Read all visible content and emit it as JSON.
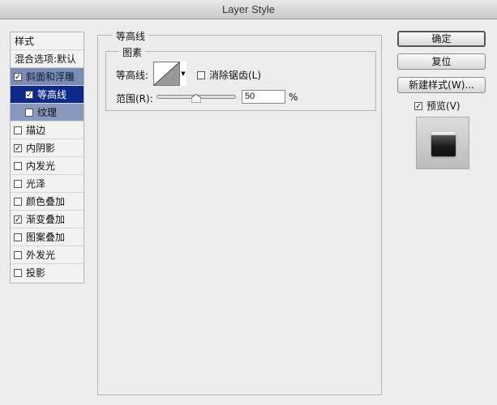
{
  "window": {
    "title": "Layer Style"
  },
  "style_list": {
    "header": "样式",
    "items": [
      {
        "label": "混合选项:默认",
        "checkbox": false
      },
      {
        "label": "斜面和浮雕",
        "checked": true
      },
      {
        "label": "等高线",
        "checked": true
      },
      {
        "label": "纹理",
        "checked": false
      },
      {
        "label": "描边",
        "checked": false
      },
      {
        "label": "内阴影",
        "checked": true
      },
      {
        "label": "内发光",
        "checked": false
      },
      {
        "label": "光泽",
        "checked": false
      },
      {
        "label": "颜色叠加",
        "checked": false
      },
      {
        "label": "渐变叠加",
        "checked": true
      },
      {
        "label": "图案叠加",
        "checked": false
      },
      {
        "label": "外发光",
        "checked": false
      },
      {
        "label": "投影",
        "checked": false
      }
    ]
  },
  "panel": {
    "title": "等高线",
    "group_title": "图素",
    "contour_label": "等高线:",
    "antialias_label": "消除锯齿(L)",
    "antialias_checked": false,
    "range_label": "范围(R):",
    "range_value": "50",
    "range_unit": "%",
    "range_level_percent": 50
  },
  "buttons": {
    "ok": "确定",
    "reset": "复位",
    "new_style": "新建样式(W)..."
  },
  "preview": {
    "label": "预览(V)",
    "checked": true
  }
}
